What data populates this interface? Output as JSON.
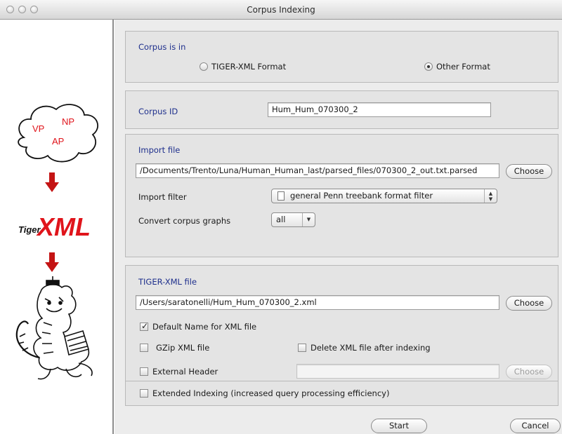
{
  "window": {
    "title": "Corpus Indexing"
  },
  "logo": {
    "bubble_labels": [
      "VP",
      "NP",
      "AP"
    ],
    "brand_small": "Tiger",
    "brand_large": "XML"
  },
  "format_section": {
    "title": "Corpus is in",
    "option_tiger": "TIGER-XML Format",
    "option_other": "Other Format",
    "selected": "Other Format"
  },
  "corpus_id": {
    "label": "Corpus ID",
    "value": "Hum_Hum_070300_2"
  },
  "import_section": {
    "title": "Import file",
    "path": "/Documents/Trento/Luna/Human_Human_last/parsed_files/070300_2_out.txt.parsed",
    "choose_label": "Choose",
    "filter_label": "Import filter",
    "filter_value": "general Penn treebank format filter",
    "convert_label": "Convert corpus graphs",
    "convert_value": "all"
  },
  "tiger_section": {
    "title": "TIGER-XML file",
    "path": "/Users/saratonelli/Hum_Hum_070300_2.xml",
    "choose_label": "Choose",
    "default_name_label": "Default Name for XML file",
    "default_name_checked": true,
    "gzip_label": "GZip XML file",
    "gzip_checked": false,
    "delete_label": "Delete XML file after indexing",
    "delete_checked": false,
    "header_label": "External Header",
    "header_checked": false,
    "header_value": "",
    "header_choose_label": "Choose"
  },
  "extended": {
    "label": "Extended Indexing (increased query processing efficiency)",
    "checked": false
  },
  "footer": {
    "start_label": "Start",
    "cancel_label": "Cancel"
  },
  "colors": {
    "section_title": "#1e2f8c",
    "logo_red": "#e0141b",
    "arrow_red": "#c41414"
  }
}
